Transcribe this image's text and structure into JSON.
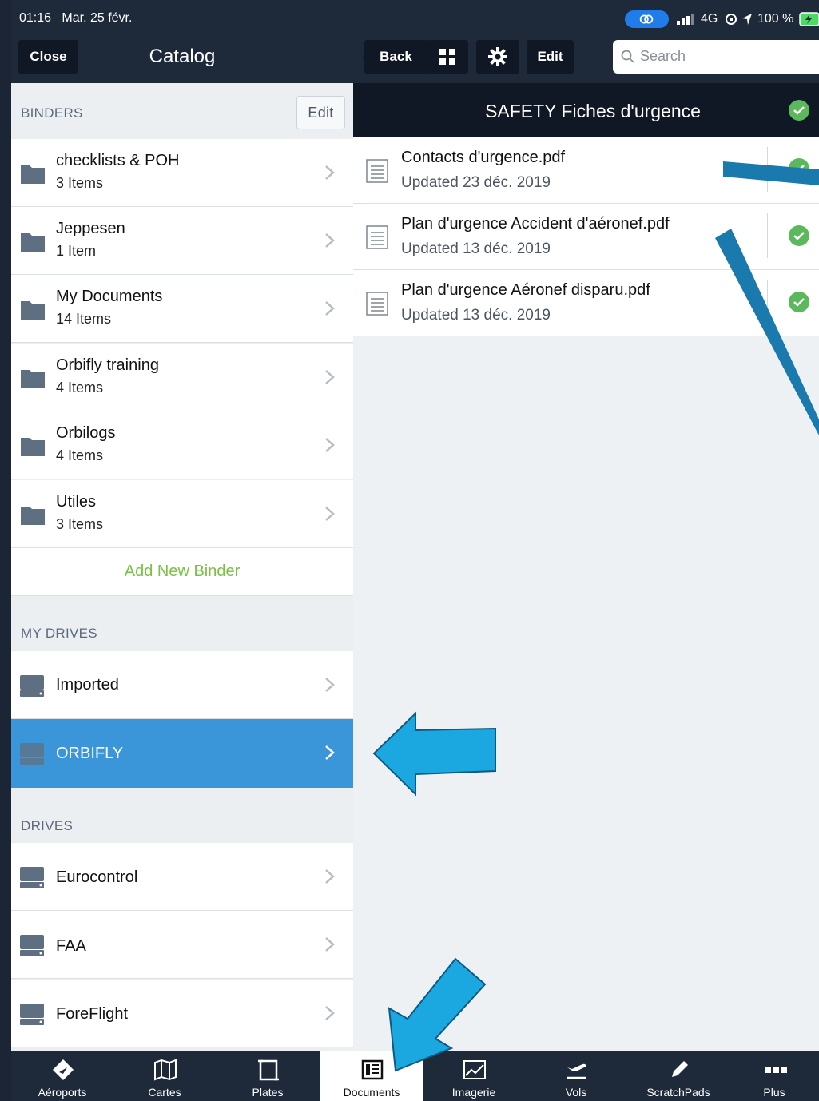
{
  "status": {
    "time": "01:16",
    "date": "Mar. 25 févr.",
    "network": "4G",
    "battery": "100 %"
  },
  "catalog": {
    "close_label": "Close",
    "title": "Catalog"
  },
  "binders": {
    "header": "BINDERS",
    "edit_label": "Edit",
    "items": [
      {
        "title": "checklists & POH",
        "count": "3 Items"
      },
      {
        "title": "Jeppesen",
        "count": "1 Item"
      },
      {
        "title": "My Documents",
        "count": "14 Items"
      },
      {
        "title": "Orbifly training",
        "count": "4 Items"
      },
      {
        "title": "Orbilogs",
        "count": "4 Items"
      },
      {
        "title": "Utiles",
        "count": "3 Items"
      }
    ],
    "add_label": "Add New Binder"
  },
  "my_drives": {
    "header": "MY DRIVES",
    "items": [
      {
        "title": "Imported"
      },
      {
        "title": "ORBIFLY"
      }
    ]
  },
  "drives": {
    "header": "DRIVES",
    "items": [
      {
        "title": "Eurocontrol"
      },
      {
        "title": "FAA"
      },
      {
        "title": "ForeFlight"
      }
    ]
  },
  "toolbar": {
    "back_label": "Back",
    "edit_label": "Edit",
    "search_placeholder": "Search"
  },
  "folder": {
    "title": "SAFETY Fiches d'urgence"
  },
  "documents": [
    {
      "name": "Contacts d'urgence.pdf",
      "updated": "Updated 23 déc. 2019"
    },
    {
      "name": "Plan d'urgence Accident d'aéronef.pdf",
      "updated": "Updated 13 déc. 2019"
    },
    {
      "name": "Plan d'urgence Aéronef disparu.pdf",
      "updated": "Updated 13 déc. 2019"
    }
  ],
  "tabs": [
    {
      "label": "Aéroports",
      "icon": "airport-icon"
    },
    {
      "label": "Cartes",
      "icon": "map-icon"
    },
    {
      "label": "Plates",
      "icon": "plates-icon"
    },
    {
      "label": "Documents",
      "icon": "documents-icon"
    },
    {
      "label": "Imagerie",
      "icon": "imagery-icon"
    },
    {
      "label": "Vols",
      "icon": "flights-icon"
    },
    {
      "label": "ScratchPads",
      "icon": "pencil-icon"
    },
    {
      "label": "Plus",
      "icon": "more-icon"
    }
  ],
  "colors": {
    "selected_row": "#3a96d8",
    "accent_green": "#7ac142",
    "check_green": "#5cb85c",
    "arrow_blue": "#1e88c8",
    "header_dark": "#1e2a3a"
  }
}
